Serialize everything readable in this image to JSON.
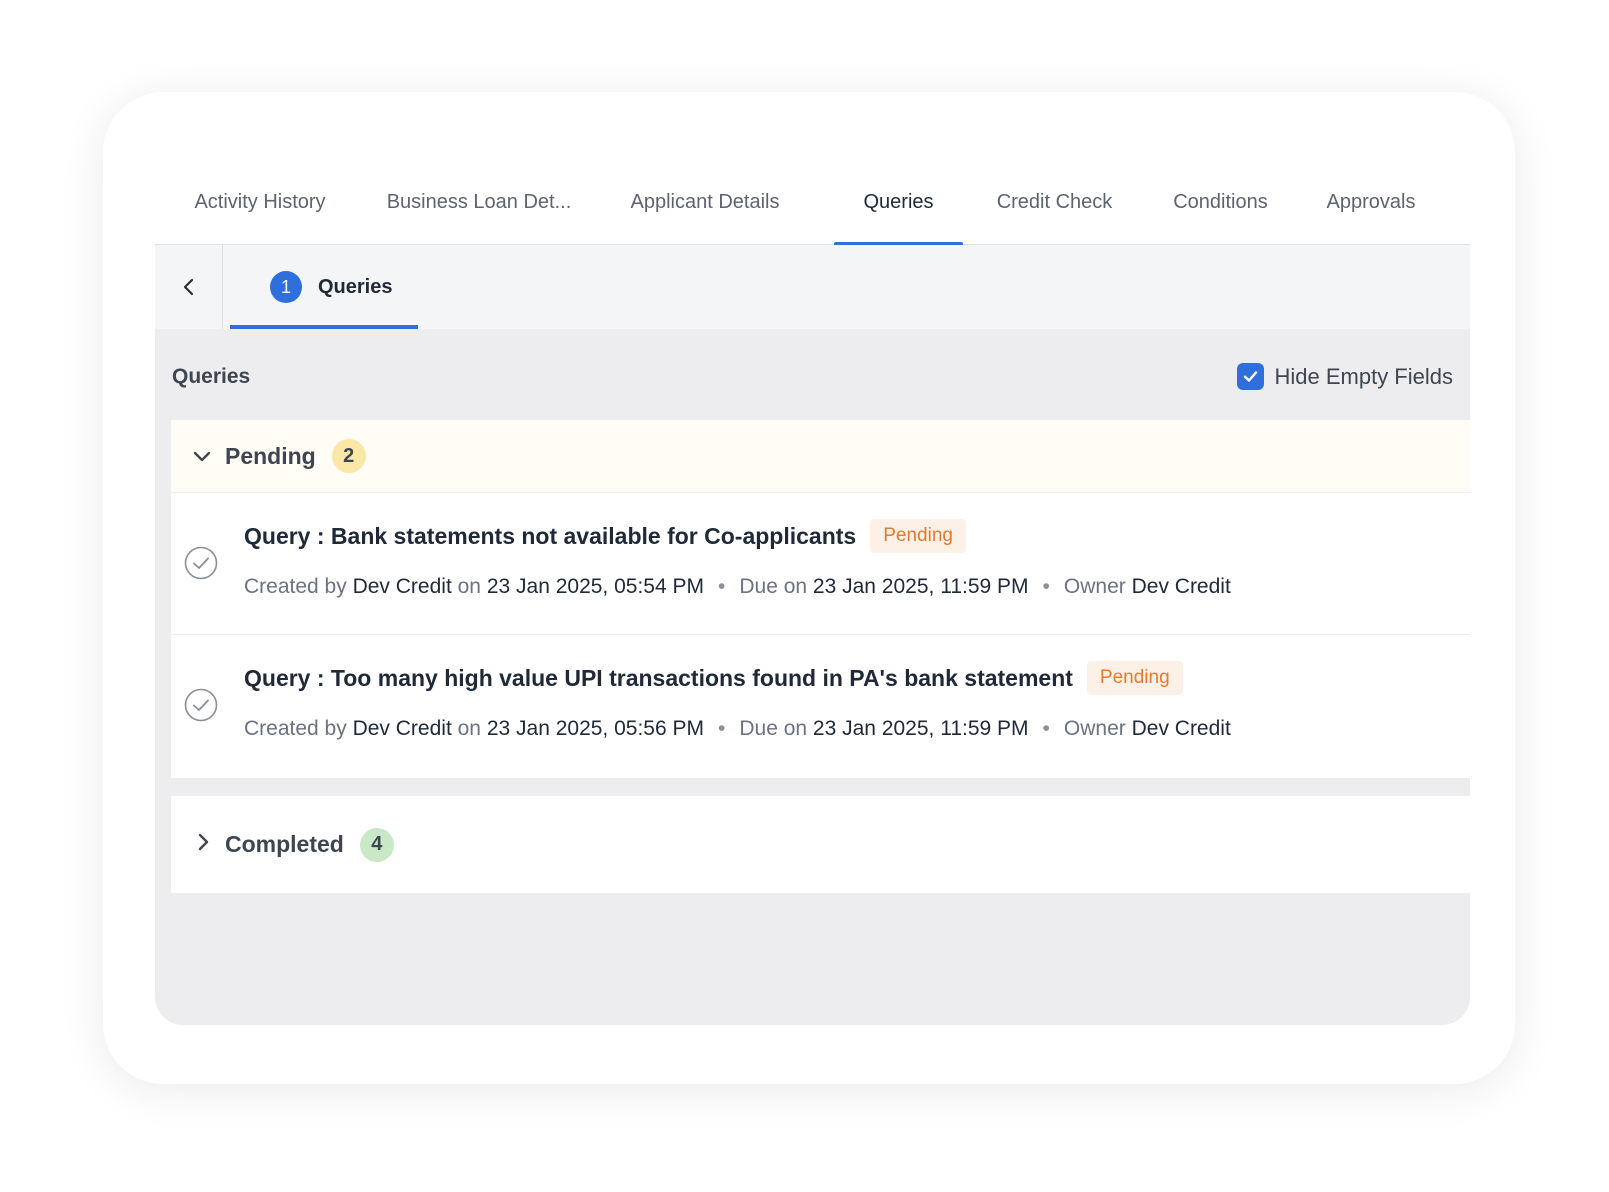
{
  "tabs": [
    {
      "label": "Activity History",
      "active": false
    },
    {
      "label": "Business Loan Det...",
      "active": false
    },
    {
      "label": "Applicant Details",
      "active": false
    },
    {
      "label": "Queries",
      "active": true
    },
    {
      "label": "Credit Check",
      "active": false
    },
    {
      "label": "Conditions",
      "active": false
    },
    {
      "label": "Approvals",
      "active": false
    }
  ],
  "stepbar": {
    "back_icon": "chevron-left-icon",
    "step_number": "1",
    "step_label": "Queries"
  },
  "section": {
    "title": "Queries",
    "hide_empty_label": "Hide Empty Fields",
    "hide_empty_checked": true
  },
  "groups": {
    "pending": {
      "label": "Pending",
      "count": "2",
      "expanded": true,
      "queries": [
        {
          "title": "Query : Bank statements not available for Co-applicants",
          "status": "Pending",
          "created_by_label": "Created by",
          "created_by": "Dev Credit",
          "on_label": "on",
          "created_on": "23 Jan 2025, 05:54 PM",
          "due_label": "Due on",
          "due_on": "23 Jan 2025, 11:59 PM",
          "owner_label": "Owner",
          "owner": "Dev Credit"
        },
        {
          "title": "Query : Too many high value UPI transactions found in PA's bank statement",
          "status": "Pending",
          "created_by_label": "Created by",
          "created_by": "Dev Credit",
          "on_label": "on",
          "created_on": "23 Jan 2025, 05:56 PM",
          "due_label": "Due on",
          "due_on": "23 Jan 2025, 11:59 PM",
          "owner_label": "Owner",
          "owner": "Dev Credit"
        }
      ]
    },
    "completed": {
      "label": "Completed",
      "count": "4",
      "expanded": false
    }
  },
  "separator": "•",
  "colors": {
    "accent": "#2f6fdc",
    "pending_badge_text": "#e47a2e",
    "pending_badge_bg": "#fdf1e7",
    "pending_count_bg": "#fbe7a6",
    "completed_count_bg": "#c9e8c6"
  }
}
